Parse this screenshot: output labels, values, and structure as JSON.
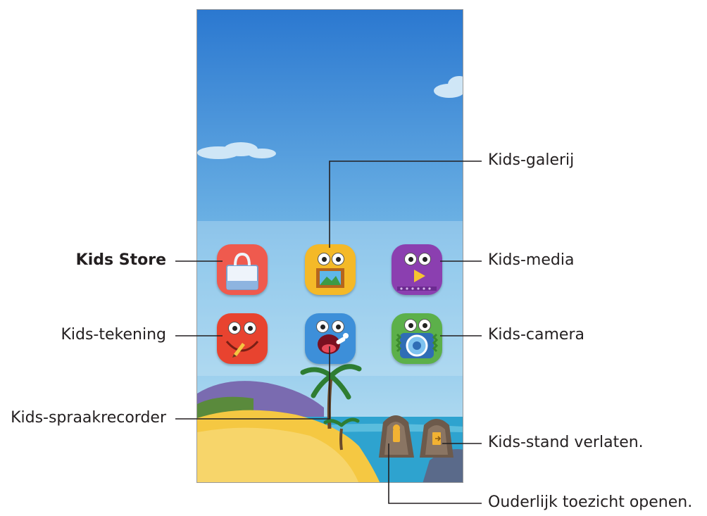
{
  "callouts": {
    "kids_store": "Kids Store",
    "kids_galerij": "Kids-galerij",
    "kids_media": "Kids-media",
    "kids_tekening": "Kids-tekening",
    "kids_camera": "Kids-camera",
    "kids_spraakrecorder": "Kids-spraakrecorder",
    "kids_stand_verlaten": "Kids-stand verlaten.",
    "ouderlijk_toezicht": "Ouderlijk toezicht openen."
  },
  "icons": {
    "store": "shopping-bag-icon",
    "gallery": "picture-frame-icon",
    "media": "play-icon",
    "drawing": "pencil-icon",
    "recorder": "microphone-icon",
    "camera": "camera-icon",
    "parental": "parental-control-icon",
    "exit": "exit-door-icon"
  },
  "colors": {
    "sky_top": "#2f7fd4",
    "sky_bottom": "#a9d6f0",
    "sea": "#2e9fc9",
    "sand": "#f3c94a",
    "callout_line": "#231f20"
  }
}
